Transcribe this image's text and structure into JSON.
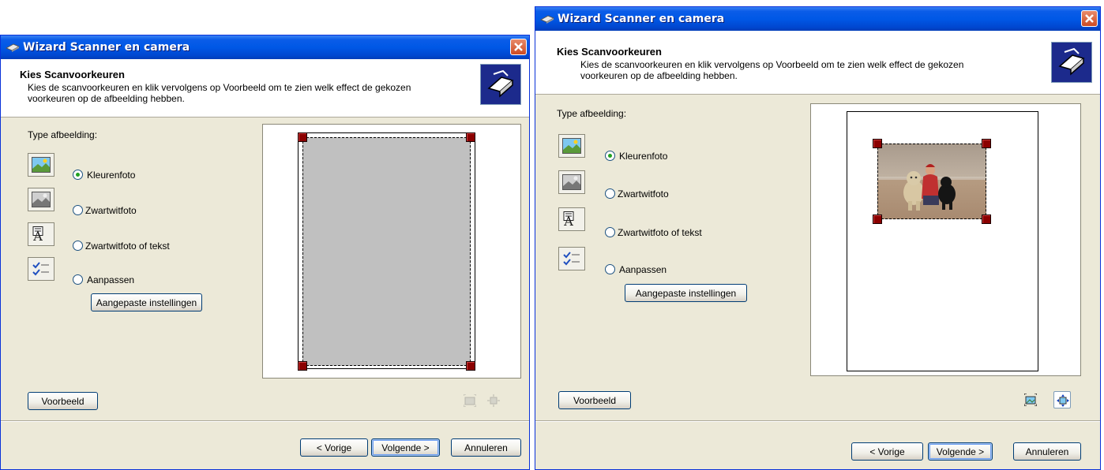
{
  "windows": [
    {
      "title": "Wizard Scanner en camera",
      "heading": "Kies Scanvoorkeuren",
      "subtitle_line1": "Kies de scanvoorkeuren en klik vervolgens op Voorbeeld om te zien welk effect de gekozen",
      "subtitle_line2": "voorkeuren op de afbeelding hebben.",
      "type_label": "Type afbeelding:",
      "options": [
        "Kleurenfoto",
        "Zwartwitfoto",
        "Zwartwitfoto of tekst",
        "Aanpassen"
      ],
      "selected_option": "Kleurenfoto",
      "custom_settings_button": "Aangepaste instellingen",
      "preview_button": "Voorbeeld",
      "back_button": "< Vorige",
      "next_button": "Volgende >",
      "cancel_button": "Annuleren",
      "preview_state": "empty",
      "zoom_buttons_enabled": false
    },
    {
      "title": "Wizard Scanner en camera",
      "heading": "Kies Scanvoorkeuren",
      "subtitle_line1": "Kies de scanvoorkeuren en klik vervolgens op Voorbeeld om te zien welk effect de gekozen",
      "subtitle_line2": "voorkeuren op de afbeelding hebben.",
      "type_label": "Type afbeelding:",
      "options": [
        "Kleurenfoto",
        "Zwartwitfoto",
        "Zwartwitfoto of tekst",
        "Aanpassen"
      ],
      "selected_option": "Kleurenfoto",
      "custom_settings_button": "Aangepaste instellingen",
      "preview_button": "Voorbeeld",
      "back_button": "< Vorige",
      "next_button": "Volgende >",
      "cancel_button": "Annuleren",
      "preview_state": "photo",
      "zoom_buttons_enabled": true
    }
  ],
  "colors": {
    "titlebar_blue": "#0058e6",
    "dialog_bg": "#ece9d8",
    "crop_handle": "#8b0000",
    "radio_selected": "#21a121",
    "preview_empty_fill": "#c0c0c0"
  },
  "icons": [
    "scanner-icon",
    "close-icon",
    "wizard-banner-icon",
    "color-photo-icon",
    "grayscale-photo-icon",
    "text-icon",
    "custom-settings-icon",
    "zoom-to-selection-icon",
    "fit-page-icon"
  ]
}
